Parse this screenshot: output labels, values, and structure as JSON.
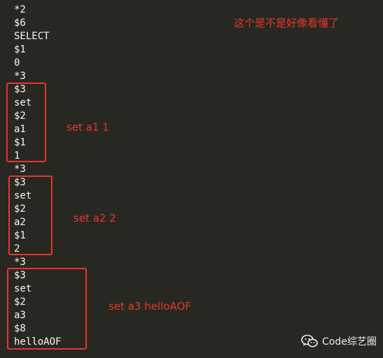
{
  "code_lines": [
    "*2",
    "$6",
    "SELECT",
    "$1",
    "0",
    "*3",
    "$3",
    "set",
    "$2",
    "a1",
    "$1",
    "1",
    "*3",
    "$3",
    "set",
    "$2",
    "a2",
    "$1",
    "2",
    "*3",
    "$3",
    "set",
    "$2",
    "a3",
    "$8",
    "helloAOF"
  ],
  "annotations": {
    "top_note": "这个是不是好像看懂了",
    "box1_label": "set a1 1",
    "box2_label": "set a2 2",
    "box3_label": "set a3 helloAOF"
  },
  "watermark": {
    "icon": "wechat-icon",
    "text": "Code综艺圈"
  },
  "colors": {
    "background": "#272822",
    "code_text": "#f8f8f2",
    "annotation_red": "#e8362b"
  }
}
